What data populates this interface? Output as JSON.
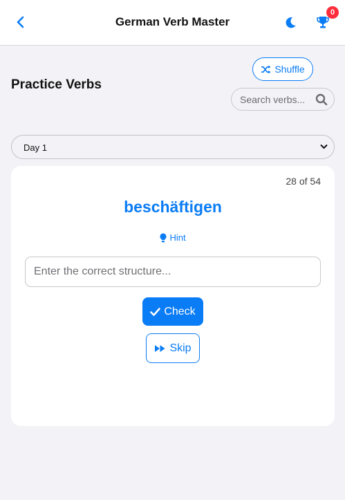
{
  "header": {
    "title": "German Verb Master",
    "back_icon": "chevron-left-icon",
    "theme_icon": "moon-icon",
    "trophy_icon": "trophy-icon",
    "trophy_count": "0"
  },
  "toolbar": {
    "shuffle_label": "Shuffle",
    "section_title": "Practice Verbs",
    "search_placeholder": "Search verbs..."
  },
  "day_select": {
    "selected": "Day 1"
  },
  "card": {
    "progress": "28 of 54",
    "verb": "beschäftigen",
    "hint_label": "Hint",
    "answer_placeholder": "Enter the correct structure...",
    "answer_value": "",
    "check_label": "Check",
    "skip_label": "Skip"
  },
  "colors": {
    "accent": "#0a7cf5",
    "badge": "#ff2d3b",
    "background": "#f2f2f7",
    "card": "#ffffff"
  }
}
